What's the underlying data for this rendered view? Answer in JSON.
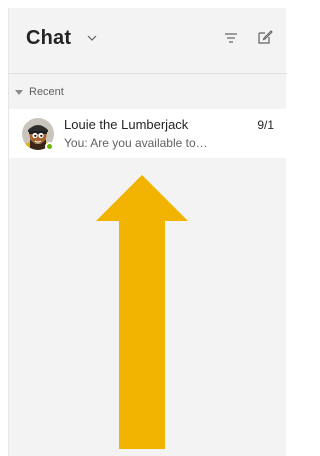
{
  "header": {
    "title": "Chat",
    "dropdown_icon": "chevron-down-icon",
    "filter_icon": "filter-icon",
    "compose_icon": "compose-icon"
  },
  "sections": [
    {
      "label": "Recent",
      "icon": "caret-down-icon"
    }
  ],
  "chats": [
    {
      "name": "Louie the Lumberjack",
      "date": "9/1",
      "preview": "You: Are you available to…",
      "presence": "available",
      "avatar": "avatar-icon"
    }
  ],
  "overlay": {
    "arrow_icon": "up-arrow-icon",
    "arrow_color": "#f2b200"
  },
  "colors": {
    "panel_bg": "#f3f3f3",
    "selected_row_bg": "#ffffff",
    "presence_available": "#6bb700"
  }
}
